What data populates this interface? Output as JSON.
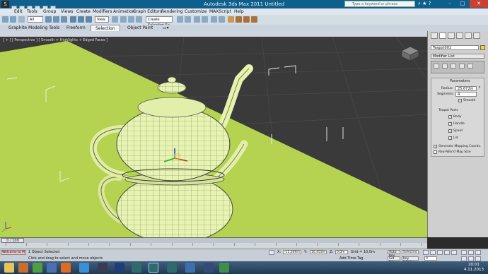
{
  "window": {
    "title": "Autodesk 3ds Max  2011     Untitled",
    "search_placeholder": "Type a keyword or phrase",
    "min_label": "–",
    "max_label": "□",
    "close_label": "✕"
  },
  "menu": [
    "Edit",
    "Tools",
    "Group",
    "Views",
    "Create",
    "Modifiers",
    "Animation",
    "Graph Editors",
    "Rendering",
    "Customize",
    "MAXScript",
    "Help"
  ],
  "toolbar": {
    "selection_filter": "All",
    "view_dropdown": "View",
    "named_selection": "Create Selection Se"
  },
  "ribbon": {
    "tabs": [
      "Graphite Modeling Tools",
      "Freeform",
      "Selection",
      "Object Paint"
    ],
    "active_tab": "Selection"
  },
  "viewport": {
    "label": "[ + ] [ Perspective ] [ Smooth + Highlights + Edged Faces ]",
    "ground_color": "#b5d350",
    "teapot_color": "#eaf5b6"
  },
  "command_panel": {
    "object_name": "Teapot001",
    "modifier_list": "Modifier List",
    "rollout_title": "Parameters",
    "radius_label": "Radius:",
    "radius_value": "25,672m",
    "segments_label": "Segments:",
    "segments_value": "4",
    "smooth_label": "Smooth",
    "teapot_parts_label": "Teapot Parts",
    "parts": [
      "Body",
      "Handle",
      "Spout",
      "Lid"
    ],
    "gen_mapping_label": "Generate Mapping Coords.",
    "real_world_label": "Real-World Map Size"
  },
  "timeline": {
    "frame": "0 / 100",
    "ticks": [
      "0",
      "5",
      "10",
      "15",
      "20",
      "25",
      "30",
      "35",
      "40",
      "45",
      "50",
      "55",
      "60",
      "65",
      "70",
      "75",
      "80",
      "85",
      "90",
      "95",
      "100"
    ]
  },
  "status": {
    "welcome": "Welcome to M",
    "selected": "1 Object Selected",
    "prompt": "Click and drag to select and move objects",
    "x_label": "X:",
    "x_value": "-11,369m",
    "y_label": "Y:",
    "y_value": "16,453m",
    "z_label": "Z:",
    "z_value": "0,0m",
    "grid": "Grid = 10,0m",
    "auto_key": "Auto Key",
    "selected_dropdown": "Selected",
    "set_key": "Set Key",
    "key_filters": "Key Filters...",
    "add_time_tag": "Add Time Tag",
    "frame_field": "0"
  },
  "taskbar": {
    "time": "20:01",
    "date": "4.11.2013",
    "apps": [
      "explorer",
      "media",
      "chrome",
      "firefox",
      "ie",
      "photoshop-alt",
      "photoshop",
      "3dsmax",
      "3dsmax-2",
      "3dsmax-3",
      "media-player",
      "mudbox",
      "chrome-2"
    ]
  }
}
